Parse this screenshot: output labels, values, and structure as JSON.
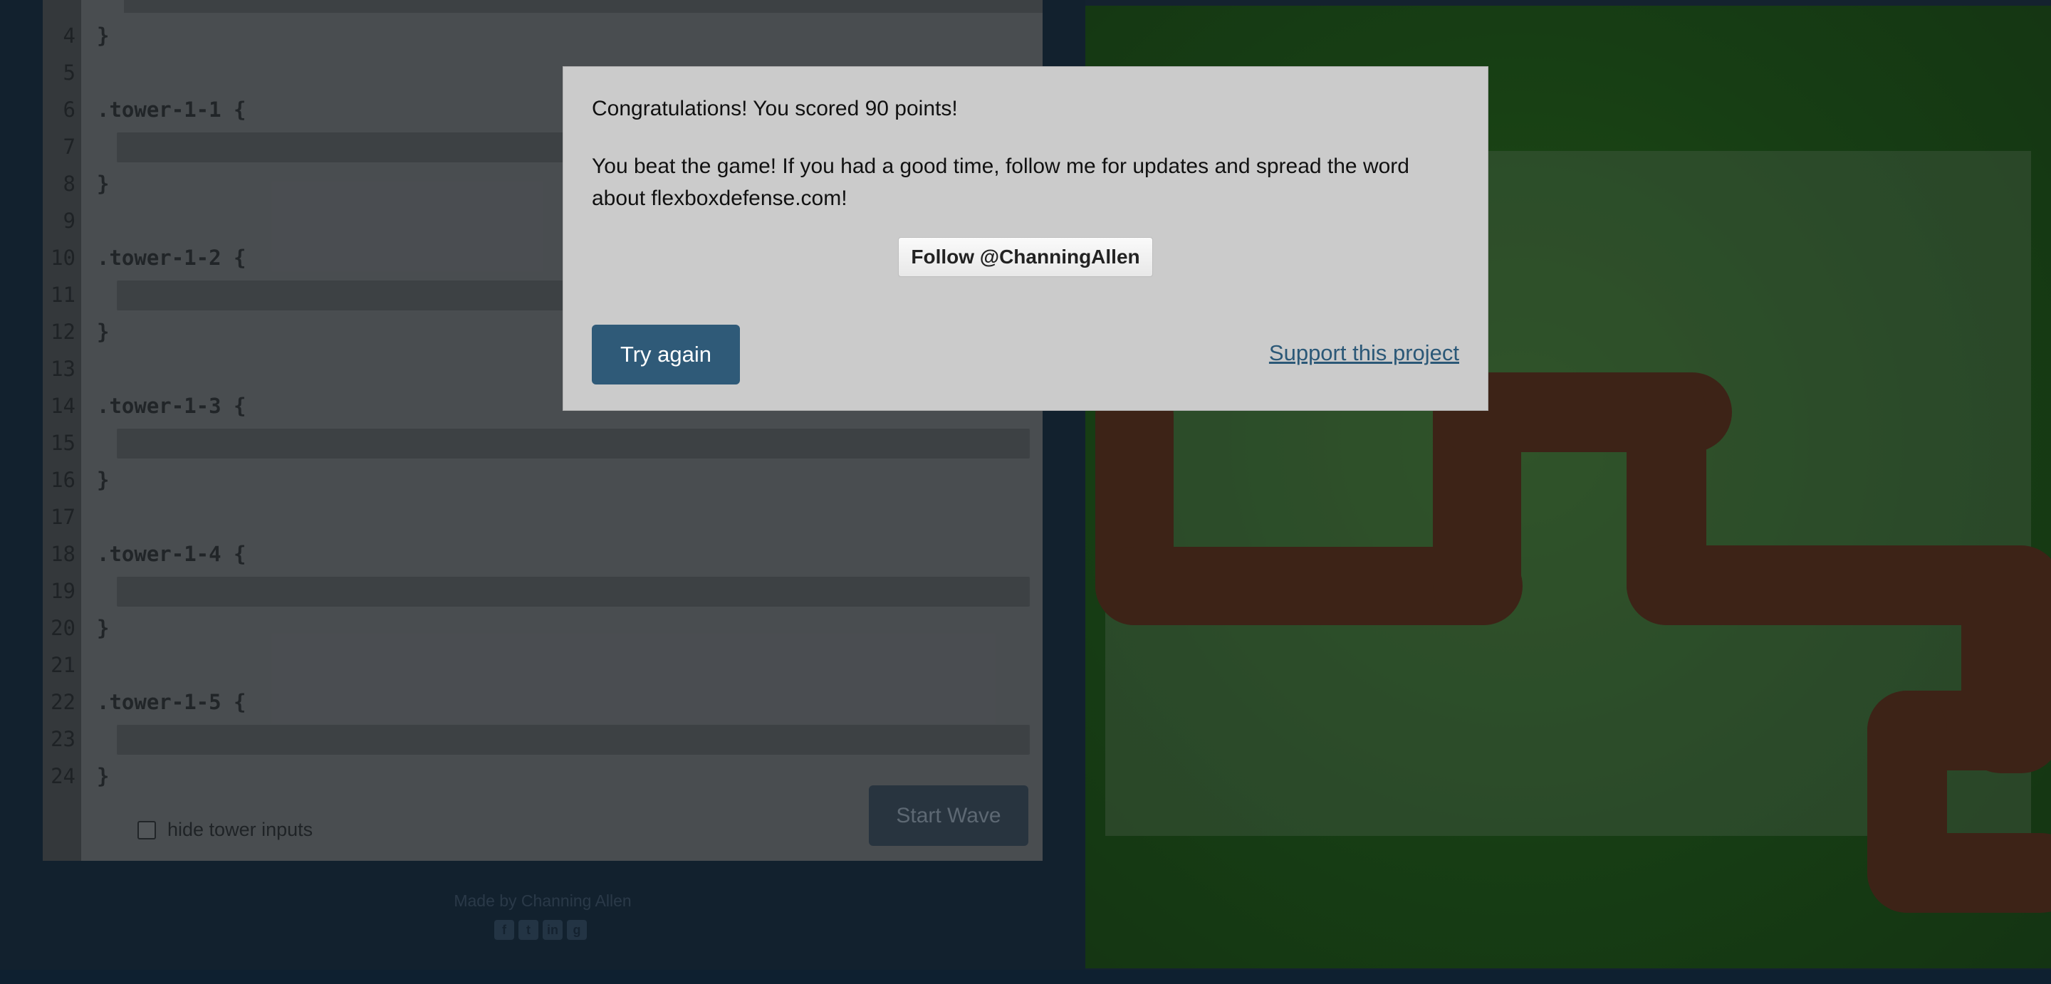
{
  "editor": {
    "lines": [
      {
        "n": "4",
        "code": "}"
      },
      {
        "n": "5",
        "code": ""
      },
      {
        "n": "6",
        "code": ".tower-1-1 {"
      },
      {
        "n": "7",
        "code": "",
        "input": true
      },
      {
        "n": "8",
        "code": "}"
      },
      {
        "n": "9",
        "code": ""
      },
      {
        "n": "10",
        "code": ".tower-1-2 {"
      },
      {
        "n": "11",
        "code": "",
        "input": true
      },
      {
        "n": "12",
        "code": "}"
      },
      {
        "n": "13",
        "code": ""
      },
      {
        "n": "14",
        "code": ".tower-1-3 {"
      },
      {
        "n": "15",
        "code": "",
        "input": true
      },
      {
        "n": "16",
        "code": "}"
      },
      {
        "n": "17",
        "code": ""
      },
      {
        "n": "18",
        "code": ".tower-1-4 {"
      },
      {
        "n": "19",
        "code": "",
        "input": true
      },
      {
        "n": "20",
        "code": "}"
      },
      {
        "n": "21",
        "code": ""
      },
      {
        "n": "22",
        "code": ".tower-1-5 {"
      },
      {
        "n": "23",
        "code": "",
        "input": true
      },
      {
        "n": "24",
        "code": "}"
      }
    ],
    "hide_label": "hide tower inputs",
    "start_wave_label": "Start Wave"
  },
  "footer": {
    "made_by": "Made by Channing Allen",
    "icons": [
      "facebook-icon",
      "twitter-icon",
      "linkedin-icon",
      "github-icon"
    ]
  },
  "modal": {
    "score_text": "Congratulations! You scored 90 points!",
    "beat_text": "You beat the game! If you had a good time, follow me for updates and spread the word about flexboxdefense.com!",
    "follow_label": "Follow @ChanningAllen",
    "try_again_label": "Try again",
    "support_label": "Support this project"
  },
  "colors": {
    "accent": "#2f5a78",
    "board": "#1f5410",
    "path": "#5a2c14"
  }
}
